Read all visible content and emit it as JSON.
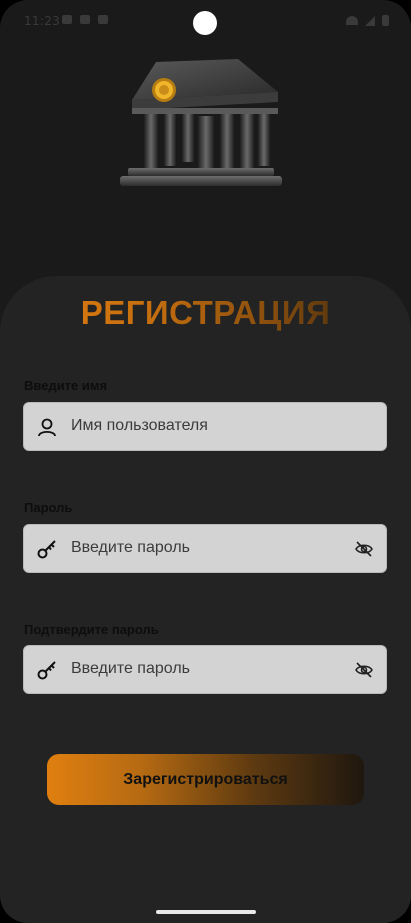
{
  "status": {
    "time": "11:23"
  },
  "title": "РЕГИСТРАЦИЯ",
  "fields": {
    "username": {
      "label": "Введите имя",
      "placeholder": "Имя пользователя"
    },
    "password": {
      "label": "Пароль",
      "placeholder": "Введите пароль"
    },
    "confirm": {
      "label": "Подтвердите пароль",
      "placeholder": "Введите пароль"
    }
  },
  "register_button": "Зарегистрироваться",
  "icons": {
    "logo": "bank-icon",
    "username": "user-icon",
    "password": "key-icon",
    "toggle": "eye-off-icon"
  },
  "colors": {
    "accent": "#e07d12",
    "background": "#1a1a1a",
    "card": "#232323",
    "field": "#d3d3d3"
  }
}
